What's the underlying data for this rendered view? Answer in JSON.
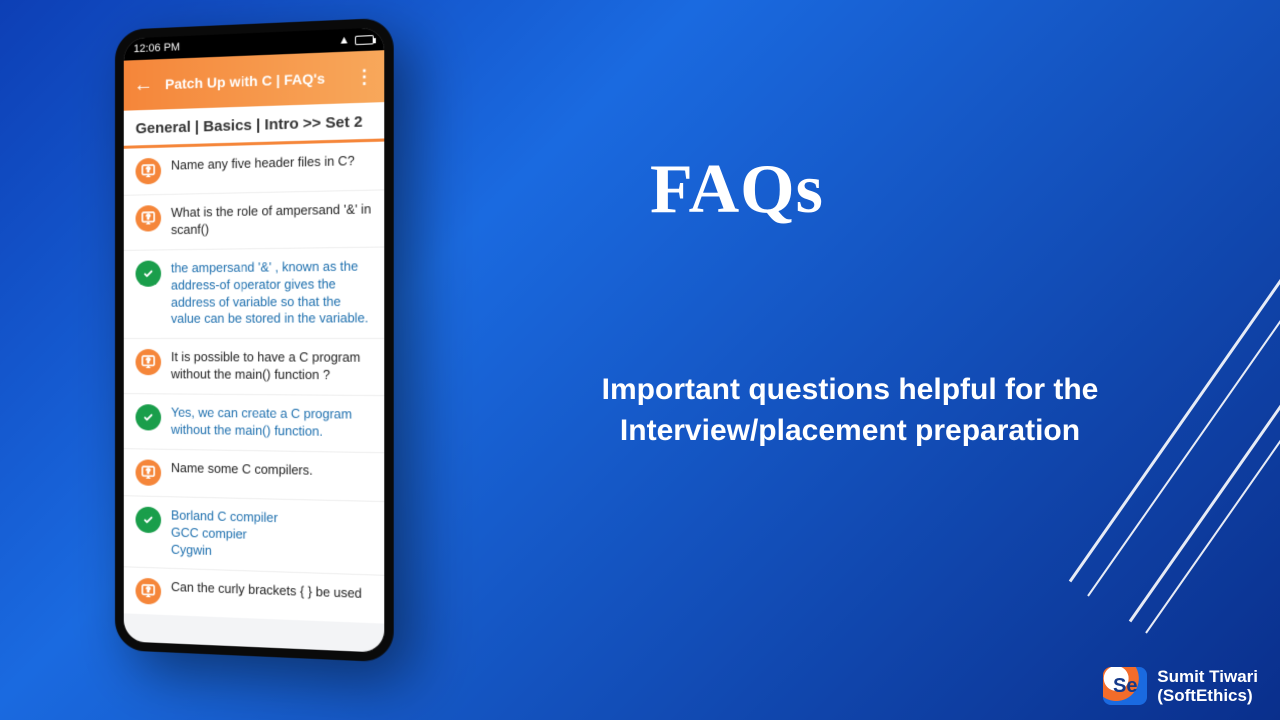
{
  "slide": {
    "title": "FAQs",
    "subtitle": "Important questions helpful for the Interview/placement preparation"
  },
  "brand": {
    "logo_text": "Se",
    "line1": "Sumit Tiwari",
    "line2": "(SoftEthics)"
  },
  "phone": {
    "status_time": "12:06 PM",
    "appbar_title": "Patch Up with C  | FAQ's",
    "section_title": "General | Basics | Intro >> Set 2",
    "items": [
      {
        "kind": "q",
        "text": "Name any five header files in C?"
      },
      {
        "kind": "q",
        "text": "What is the role of ampersand '&' in scanf()"
      },
      {
        "kind": "a",
        "text": "the ampersand '&' , known as the address-of operator gives the address of variable so that the value can be stored in the variable."
      },
      {
        "kind": "q",
        "text": "It is possible to have a C program without the main() function ?"
      },
      {
        "kind": "a",
        "text": "Yes, we can create a C program without the main() function."
      },
      {
        "kind": "q",
        "text": "Name some C compilers."
      },
      {
        "kind": "l",
        "text": "Borland C compiler\nGCC compier\nCygwin"
      },
      {
        "kind": "q",
        "text": "Can the curly brackets { } be used"
      }
    ]
  }
}
